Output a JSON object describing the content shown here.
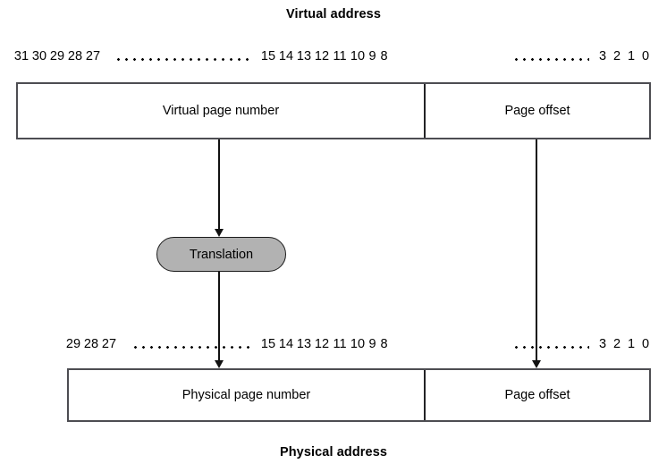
{
  "diagram": {
    "title_top": "Virtual address",
    "title_bottom": "Physical address",
    "translation": {
      "label": "Translation",
      "fill_color": "#b2b2b2",
      "border_color": "#1b1b1b"
    },
    "virtual_address": {
      "fields": [
        {
          "name": "virtual-page-number",
          "label": "Virtual page number",
          "bit_high": 31,
          "bit_low": 12
        },
        {
          "name": "page-offset",
          "label": "Page offset",
          "bit_high": 11,
          "bit_low": 0
        }
      ],
      "bit_labels_left": [
        "31",
        "30",
        "29",
        "28",
        "27"
      ],
      "bit_labels_mid": [
        "15",
        "14",
        "13",
        "12",
        "11",
        "10",
        "9",
        "8"
      ],
      "bit_labels_right": [
        "3",
        "2",
        "1",
        "0"
      ],
      "ellipsis_1": "··················",
      "ellipsis_2": "··········"
    },
    "physical_address": {
      "fields": [
        {
          "name": "physical-page-number",
          "label": "Physical page number",
          "bit_high": 29,
          "bit_low": 12
        },
        {
          "name": "page-offset",
          "label": "Page offset",
          "bit_high": 11,
          "bit_low": 0
        }
      ],
      "bit_labels_left": [
        "29",
        "28",
        "27"
      ],
      "bit_labels_mid": [
        "15",
        "14",
        "13",
        "12",
        "11",
        "10",
        "9",
        "8"
      ],
      "bit_labels_right": [
        "3",
        "2",
        "1",
        "0"
      ],
      "ellipsis_1": "··················",
      "ellipsis_2": "··········"
    },
    "connectors": [
      {
        "name": "vpn-to-translation",
        "from": "virtual-page-number",
        "to": "translation"
      },
      {
        "name": "translation-to-ppn",
        "from": "translation",
        "to": "physical-page-number"
      },
      {
        "name": "offset-passthrough",
        "from": "virtual-page-offset",
        "to": "physical-page-offset"
      }
    ]
  }
}
